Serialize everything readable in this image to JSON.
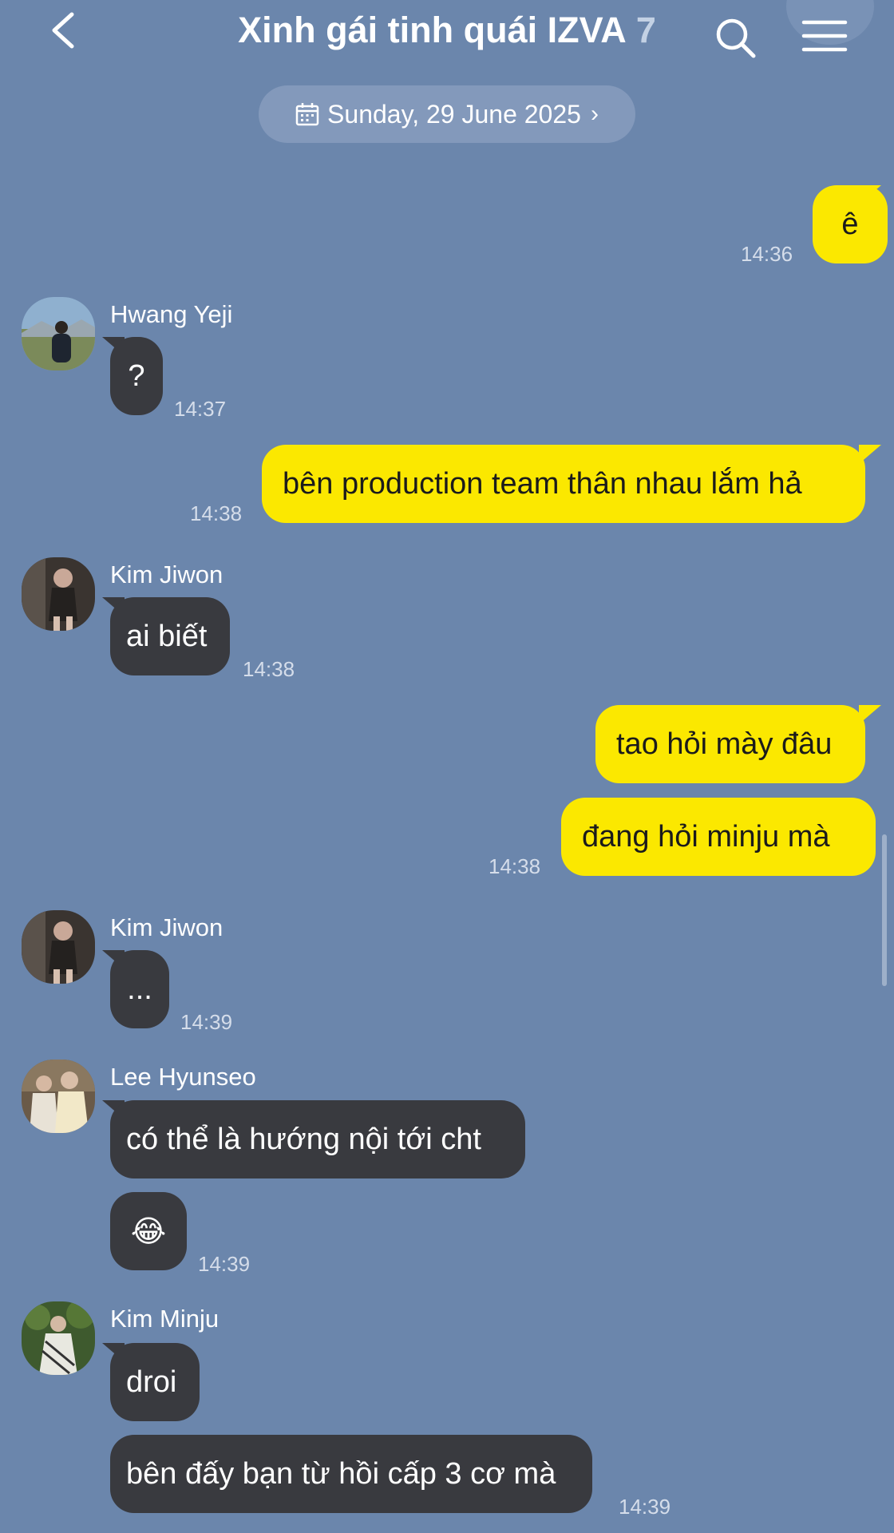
{
  "header": {
    "title": "Xinh gái tinh quái IZVA",
    "member_count": "7"
  },
  "date_pill": {
    "label": "Sunday, 29 June 2025"
  },
  "messages": [
    {
      "sender": "me",
      "text": "ê",
      "time": "14:36"
    },
    {
      "sender": "Hwang Yeji",
      "text": "?",
      "time": "14:37"
    },
    {
      "sender": "me",
      "text": "bên production team thân nhau lắm hả",
      "time": "14:38"
    },
    {
      "sender": "Kim Jiwon",
      "text": "ai biết",
      "time": "14:38"
    },
    {
      "sender": "me",
      "text": "tao hỏi mày đâu"
    },
    {
      "sender": "me",
      "text": "đang hỏi minju mà",
      "time": "14:38"
    },
    {
      "sender": "Kim Jiwon",
      "text": "...",
      "time": "14:39"
    },
    {
      "sender": "Lee Hyunseo",
      "text": "có thể là hướng nội tới cht"
    },
    {
      "sender": "Lee Hyunseo",
      "text": "😂",
      "time": "14:39"
    },
    {
      "sender": "Kim Minju",
      "text": "droi"
    },
    {
      "sender": "Kim Minju",
      "text": "bên đấy bạn từ hồi cấp 3 cơ mà",
      "time": "14:39"
    }
  ],
  "icons": {
    "back": "chevron-left-icon",
    "search": "search-icon",
    "menu": "hamburger-menu-icon",
    "calendar": "calendar-icon",
    "date_chevron": "chevron-right-icon"
  },
  "colors": {
    "background": "#6b86ac",
    "outgoing_bubble": "#fbe800",
    "incoming_bubble": "#393a3f",
    "date_pill": "#8399bb"
  }
}
